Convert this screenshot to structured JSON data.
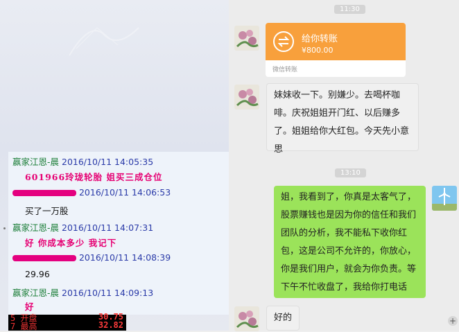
{
  "qq_chat": {
    "messages": [
      {
        "sender": "赢家江恩-晨",
        "time": "2016/10/11 14:05:35",
        "text": "601966玲珑轮胎  姐买三成仓位"
      },
      {
        "sender": "",
        "time": "2016/10/11 14:06:53",
        "text": "买了一万股"
      },
      {
        "sender": "赢家江恩-晨",
        "time": "2016/10/11 14:07:31",
        "text": "好  你成本多少  我记下"
      },
      {
        "sender": "",
        "time": "2016/10/11 14:08:39",
        "text": "29.96"
      },
      {
        "sender": "赢家江恩-晨",
        "time": "2016/10/11 14:09:13",
        "text": "好"
      }
    ]
  },
  "stock_panel": {
    "rows": [
      {
        "label": "5 开盘",
        "value": "30.75"
      },
      {
        "label": "7 最高",
        "value": "32.82"
      }
    ]
  },
  "wechat": {
    "time1": "11:30",
    "transfer": {
      "title": "给你转账",
      "amount": "¥800.00",
      "footer": "微信转账"
    },
    "msg1": "妹妹收一下。别嫌少。去喝杯咖啡。庆祝姐姐开门红、以后赚多了。姐姐给你大红包。今天先小意思",
    "time2": "13:10",
    "msg2": "姐，我看到了，你真是太客气了，股票赚钱也是因为你的信任和我们团队的分析，我不能私下收你红包，这是公司不允许的，你放心，你是我们用户，就会为你负责。等下午不忙收盘了，我给你打电话",
    "msg3": "好的"
  },
  "colors": {
    "green_bubble": "#9be35a",
    "transfer_orange": "#f8a03c",
    "qq_highlight": "#e60073",
    "qq_sender": "#1d7f3a",
    "qq_time": "#2a3aa8"
  },
  "icons": [
    "avatar-flower-icon",
    "avatar-windmill-icon",
    "transfer-arrows-icon",
    "zoom-icon"
  ]
}
